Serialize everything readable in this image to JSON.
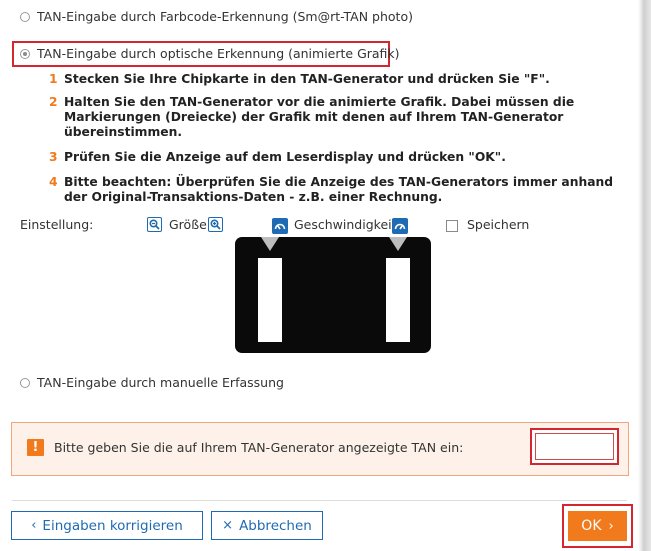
{
  "options": {
    "color_code": "TAN-Eingabe durch Farbcode-Erkennung (Sm@rt-TAN photo)",
    "optical": "TAN-Eingabe durch optische Erkennung (animierte Grafik)",
    "manual": "TAN-Eingabe durch manuelle Erfassung",
    "selected": "optical"
  },
  "steps": [
    {
      "num": "1",
      "text": "Stecken Sie Ihre Chipkarte in den TAN-Generator und drücken Sie \"F\"."
    },
    {
      "num": "2",
      "text": "Halten Sie den TAN-Generator vor die animierte Grafik. Dabei müssen die Markierungen (Dreiecke) der Grafik mit denen auf Ihrem TAN-Generator übereinstimmen."
    },
    {
      "num": "3",
      "text": "Prüfen Sie die Anzeige auf dem Leserdisplay und drücken \"OK\"."
    },
    {
      "num": "4",
      "text": "Bitte beachten: Überprüfen Sie die Anzeige des TAN-Generators immer anhand der Original-Transaktions-Daten - z.B. einer Rechnung."
    }
  ],
  "settings": {
    "label": "Einstellung:",
    "size_label": "Größe",
    "speed_label": "Geschwindigkeit",
    "save_label": "Speichern",
    "save_checked": false,
    "icons": [
      "zoom-out-icon",
      "zoom-in-icon",
      "speed-slower-icon",
      "speed-faster-icon"
    ]
  },
  "tan": {
    "prompt": "Bitte geben Sie die auf Ihrem TAN-Generator angezeigte TAN ein:",
    "value": "",
    "warning_icon": "!"
  },
  "buttons": {
    "correct": "Eingaben korrigieren",
    "cancel": "Abbrechen",
    "ok": "OK",
    "correct_icon": "‹",
    "cancel_icon": "×",
    "ok_icon": "›"
  },
  "colors": {
    "accent": "#f07a1c",
    "link": "#1f6bb3",
    "highlight": "#d3262f",
    "warning_bg": "#fdf1ea"
  }
}
